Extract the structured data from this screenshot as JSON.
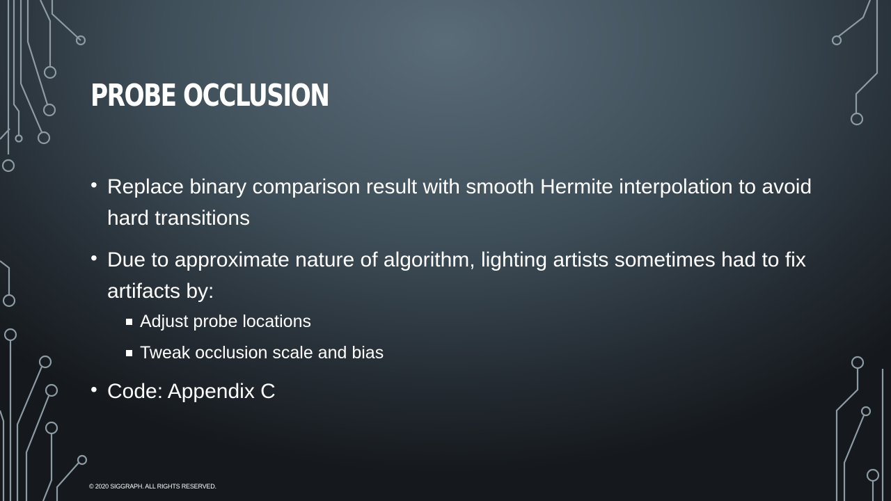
{
  "slide": {
    "title": "Probe Occlusion",
    "bullets": [
      {
        "text": "Replace binary comparison result with smooth Hermite interpolation to avoid hard transitions"
      },
      {
        "text": "Due to approximate nature of algorithm, lighting artists sometimes had to fix artifacts by:"
      },
      {
        "text": "Code: Appendix C"
      }
    ],
    "sub_bullets": [
      {
        "text": "Adjust probe locations"
      },
      {
        "text": "Tweak occlusion scale and bias"
      }
    ],
    "footer": "© 2020 SIGGRAPH. ALL RIGHTS RESERVED."
  },
  "colors": {
    "background_light": "#5a6c78",
    "background_dark": "#15191d",
    "circuit_lines": "#8d9ba4",
    "text": "#ffffff"
  }
}
